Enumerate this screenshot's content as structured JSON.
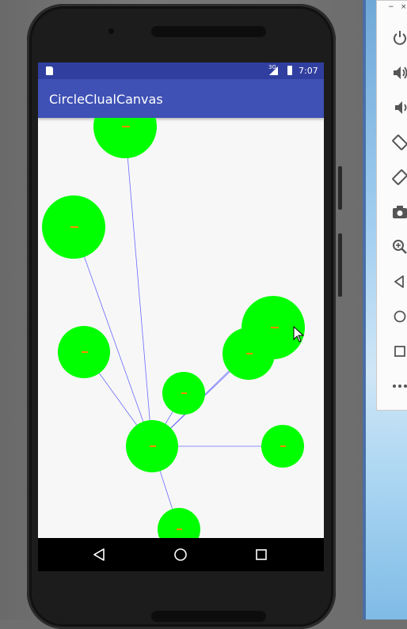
{
  "app": {
    "title": "CircleClualCanvas",
    "status_time": "7:07",
    "status_network": "3G"
  },
  "colors": {
    "status_bar": "#303f9f",
    "app_bar": "#3f51b5",
    "circle_fill": "#00ff00",
    "edge_stroke": "#6a6aff",
    "canvas_bg": "#f7f7f7"
  },
  "navigation": {
    "back": "back-icon",
    "home": "home-icon",
    "recents": "recents-icon"
  },
  "emulator_toolbar": {
    "window_controls": [
      "−",
      "×"
    ],
    "buttons": [
      "power-icon",
      "volume-up-icon",
      "volume-down-icon",
      "rotate-left-icon",
      "rotate-right-icon",
      "camera-icon",
      "zoom-icon",
      "back-icon",
      "home-icon",
      "overview-icon",
      "more-icon"
    ]
  }
}
